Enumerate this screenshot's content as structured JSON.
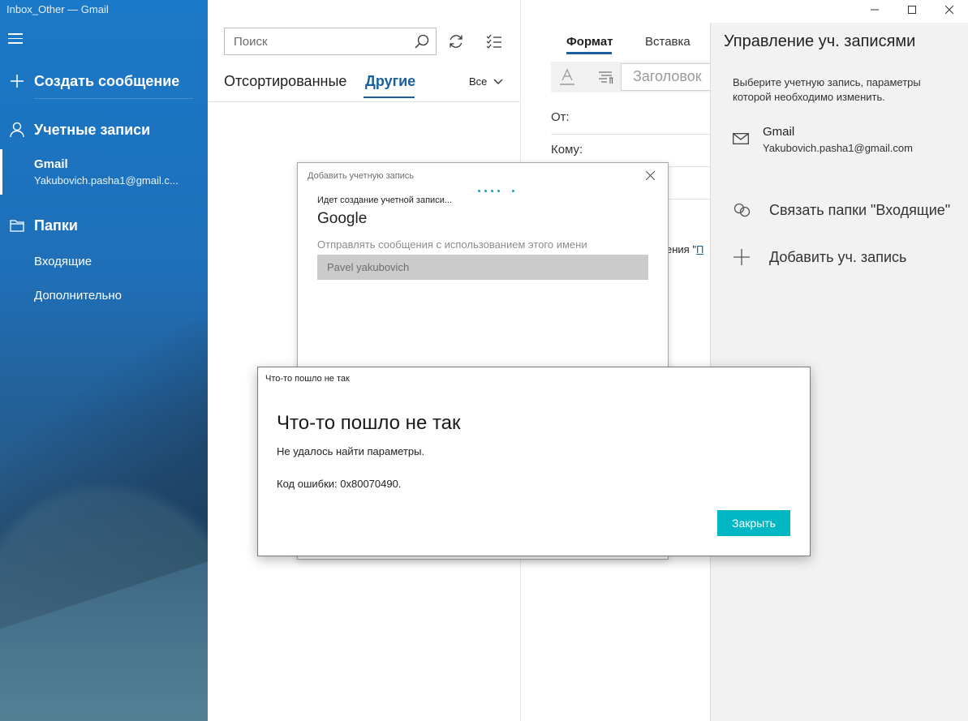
{
  "window": {
    "title": "Inbox_Other — Gmail"
  },
  "sidebar": {
    "compose_label": "Создать сообщение",
    "accounts_label": "Учетные записи",
    "account": {
      "name": "Gmail",
      "email": "Yakubovich.pasha1@gmail.c..."
    },
    "folders_label": "Папки",
    "folders": [
      "Входящие",
      "Дополнительно"
    ]
  },
  "list": {
    "search_placeholder": "Поиск",
    "tabs": [
      "Отсортированные",
      "Другие"
    ],
    "filter_label": "Все"
  },
  "compose": {
    "tabs": [
      "Формат",
      "Вставка"
    ],
    "heading_select": "Заголовок",
    "from_label": "От:",
    "to_label": "Кому:",
    "body_snippet": "ения \"",
    "body_link": "П"
  },
  "account_panel": {
    "title": "Управление уч. записями",
    "description": "Выберите учетную запись, параметры которой необходимо изменить.",
    "account": {
      "name": "Gmail",
      "email": "Yakubovich.pasha1@gmail.com"
    },
    "link_inbox_label": "Связать папки \"Входящие\"",
    "add_account_label": "Добавить уч. запись"
  },
  "add_dialog": {
    "title": "Добавить учетную запись",
    "creating_text": "Идет создание учетной записи...",
    "provider": "Google",
    "send_as_label": "Отправлять сообщения с использованием этого имени",
    "name_value": "Pavel yakubovich"
  },
  "error_dialog": {
    "titlebar": "Что-то пошло не так",
    "heading": "Что-то пошло не так",
    "message": "Не удалось найти параметры.",
    "code": "Код ошибки: 0x80070490.",
    "close_label": "Закрыть"
  },
  "colors": {
    "accent": "#1a5f9e",
    "button": "#00b7c3",
    "sidebar": "#1a79c8"
  }
}
